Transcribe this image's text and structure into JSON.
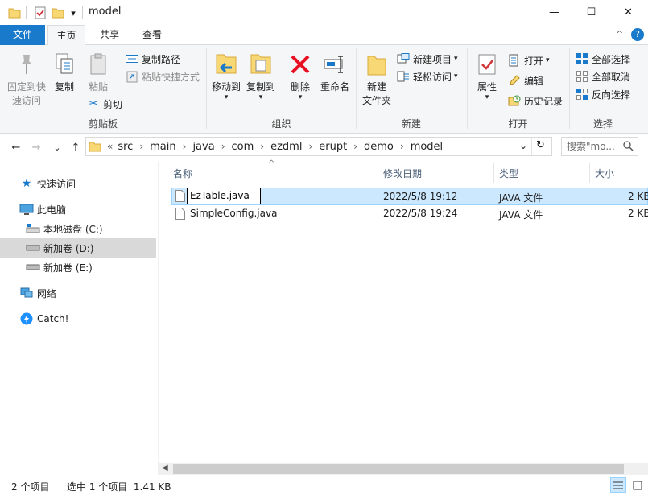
{
  "window": {
    "title": "model",
    "minimize_glyph": "—",
    "maximize_glyph": "☐",
    "close_glyph": "✕"
  },
  "quick_access": {
    "dropdown_glyph": "▾"
  },
  "ribbon_tabs": [
    {
      "label": "文件"
    },
    {
      "label": "主页"
    },
    {
      "label": "共享"
    },
    {
      "label": "查看"
    }
  ],
  "ribbon_controls": {
    "collapse": "^",
    "help": "?"
  },
  "ribbon": {
    "clipboard": {
      "group_label": "剪贴板",
      "pin_label_1": "固定到快",
      "pin_label_2": "速访问",
      "copy_label": "复制",
      "paste_label": "粘贴",
      "copy_path_label": "复制路径",
      "paste_shortcut_label": "粘贴快捷方式",
      "cut_label": "剪切"
    },
    "organize": {
      "group_label": "组织",
      "move_to_label": "移动到",
      "copy_to_label": "复制到",
      "delete_label": "删除",
      "rename_label": "重命名"
    },
    "new": {
      "group_label": "新建",
      "new_folder_label_1": "新建",
      "new_folder_label_2": "文件夹",
      "new_item_label": "新建项目",
      "easy_access_label": "轻松访问"
    },
    "open": {
      "group_label": "打开",
      "properties_label": "属性",
      "open_label": "打开",
      "edit_label": "编辑",
      "history_label": "历史记录"
    },
    "select": {
      "group_label": "选择",
      "select_all_label": "全部选择",
      "select_none_label": "全部取消",
      "invert_label": "反向选择"
    }
  },
  "nav_buttons": {
    "back": "←",
    "forward": "→",
    "recent": "⌄",
    "up": "↑"
  },
  "address": {
    "overflow": "«",
    "crumbs": [
      "src",
      "main",
      "java",
      "com",
      "ezdml",
      "erupt",
      "demo",
      "model"
    ],
    "dropdown_glyph": "⌄",
    "refresh_glyph": "↻"
  },
  "search": {
    "placeholder": "搜索\"mo..."
  },
  "nav_pane": {
    "quick_access": "快速访问",
    "this_pc": "此电脑",
    "local_disk_c": "本地磁盘 (C:)",
    "new_volume_d": "新加卷 (D:)",
    "new_volume_e": "新加卷 (E:)",
    "network": "网络",
    "catch": "Catch!"
  },
  "columns": {
    "name": "名称",
    "modified": "修改日期",
    "type": "类型",
    "size": "大小",
    "sort_glyph": "^"
  },
  "files": [
    {
      "name": "EzTable.java",
      "modified": "2022/5/8 19:12",
      "type": "JAVA 文件",
      "size": "2 KB"
    },
    {
      "name": "SimpleConfig.java",
      "modified": "2022/5/8 19:24",
      "type": "JAVA 文件",
      "size": "2 KB"
    }
  ],
  "rename_value": "EzTable.java",
  "status": {
    "item_count": "2 个项目",
    "selection": "选中 1 个项目  1.41 KB"
  },
  "colors": {
    "accent": "#1979ca",
    "selection": "#cce8ff",
    "selection_border": "#99d1ff",
    "ribbon_bg": "#f5f6f7"
  }
}
